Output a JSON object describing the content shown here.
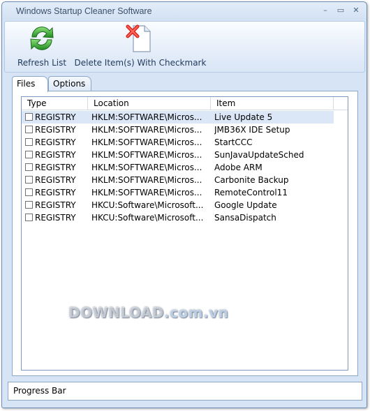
{
  "window": {
    "title": "Windows Startup Cleaner Software",
    "controls": {
      "minimize": "–",
      "maximize": "▭",
      "close": "✕"
    }
  },
  "toolbar": {
    "refresh_label": "Refresh List",
    "refresh_icon": "refresh-arrows-icon",
    "delete_label": "Delete Item(s) With Checkmark",
    "delete_icon": "delete-document-icon"
  },
  "tabs": [
    {
      "label": "Files",
      "active": true
    },
    {
      "label": "Options",
      "active": false
    }
  ],
  "list": {
    "columns": [
      "Type",
      "Location",
      "Item"
    ],
    "rows": [
      {
        "type": "REGISTRY",
        "location": "HKLM:SOFTWARE\\Micros...",
        "item": "Live Update 5",
        "checked": false,
        "selected": true
      },
      {
        "type": "REGISTRY",
        "location": "HKLM:SOFTWARE\\Micros...",
        "item": "JMB36X IDE Setup",
        "checked": false,
        "selected": false
      },
      {
        "type": "REGISTRY",
        "location": "HKLM:SOFTWARE\\Micros...",
        "item": "StartCCC",
        "checked": false,
        "selected": false
      },
      {
        "type": "REGISTRY",
        "location": "HKLM:SOFTWARE\\Micros...",
        "item": "SunJavaUpdateSched",
        "checked": false,
        "selected": false
      },
      {
        "type": "REGISTRY",
        "location": "HKLM:SOFTWARE\\Micros...",
        "item": "Adobe ARM",
        "checked": false,
        "selected": false
      },
      {
        "type": "REGISTRY",
        "location": "HKLM:SOFTWARE\\Micros...",
        "item": "Carbonite Backup",
        "checked": false,
        "selected": false
      },
      {
        "type": "REGISTRY",
        "location": "HKLM:SOFTWARE\\Micros...",
        "item": "RemoteControl11",
        "checked": false,
        "selected": false
      },
      {
        "type": "REGISTRY",
        "location": "HKCU:Software\\Microsoft...",
        "item": "Google Update",
        "checked": false,
        "selected": false
      },
      {
        "type": "REGISTRY",
        "location": "HKCU:Software\\Microsoft...",
        "item": "SansaDispatch",
        "checked": false,
        "selected": false
      }
    ]
  },
  "watermark": {
    "part1": "DOWNLOAD",
    "part2": ".com.vn"
  },
  "status": {
    "progress_label": "Progress Bar"
  },
  "colors": {
    "selection": "#dbe7f7",
    "chrome": "#d6e4f5",
    "border": "#8da7c8"
  }
}
